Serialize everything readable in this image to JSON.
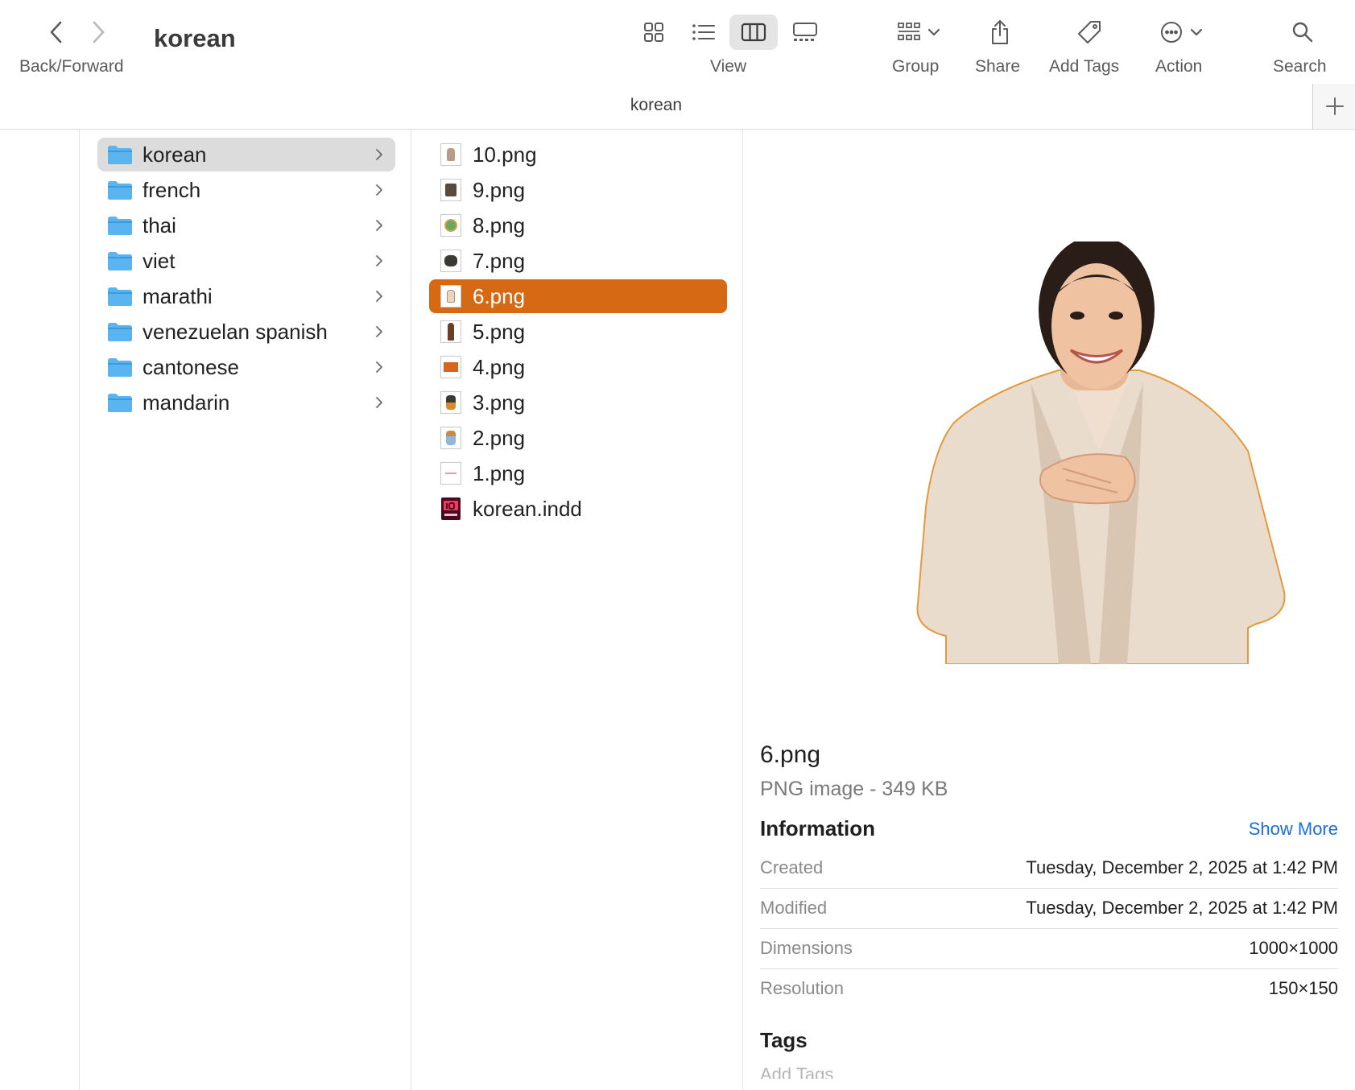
{
  "window": {
    "title": "korean"
  },
  "toolbar": {
    "back_forward_label": "Back/Forward",
    "view_label": "View",
    "group_label": "Group",
    "share_label": "Share",
    "add_tags_label": "Add Tags",
    "action_label": "Action",
    "search_label": "Search"
  },
  "pathbar": {
    "text": "korean"
  },
  "folders": {
    "items": [
      {
        "name": "korean",
        "selected": true
      },
      {
        "name": "french"
      },
      {
        "name": "thai"
      },
      {
        "name": "viet"
      },
      {
        "name": "marathi"
      },
      {
        "name": "venezuelan spanish"
      },
      {
        "name": "cantonese"
      },
      {
        "name": "mandarin"
      }
    ]
  },
  "files": {
    "items": [
      {
        "name": "10.png"
      },
      {
        "name": "9.png"
      },
      {
        "name": "8.png"
      },
      {
        "name": "7.png"
      },
      {
        "name": "6.png",
        "selected": true
      },
      {
        "name": "5.png"
      },
      {
        "name": "4.png"
      },
      {
        "name": "3.png"
      },
      {
        "name": "2.png"
      },
      {
        "name": "1.png"
      },
      {
        "name": "korean.indd"
      }
    ]
  },
  "info": {
    "file_name": "6.png",
    "kind": "PNG image - 349 KB",
    "section_title": "Information",
    "show_more": "Show More",
    "rows": [
      {
        "key": "Created",
        "value": "Tuesday, December 2, 2025 at 1:42 PM"
      },
      {
        "key": "Modified",
        "value": "Tuesday, December 2, 2025 at 1:42 PM"
      },
      {
        "key": "Dimensions",
        "value": "1000×1000"
      },
      {
        "key": "Resolution",
        "value": "150×150"
      }
    ],
    "tags_title": "Tags",
    "add_tags_placeholder": "Add Tags"
  },
  "colors": {
    "selection_accent": "#d66a14",
    "link": "#1b6fd8",
    "folder_blue": "#5ab4f0"
  }
}
